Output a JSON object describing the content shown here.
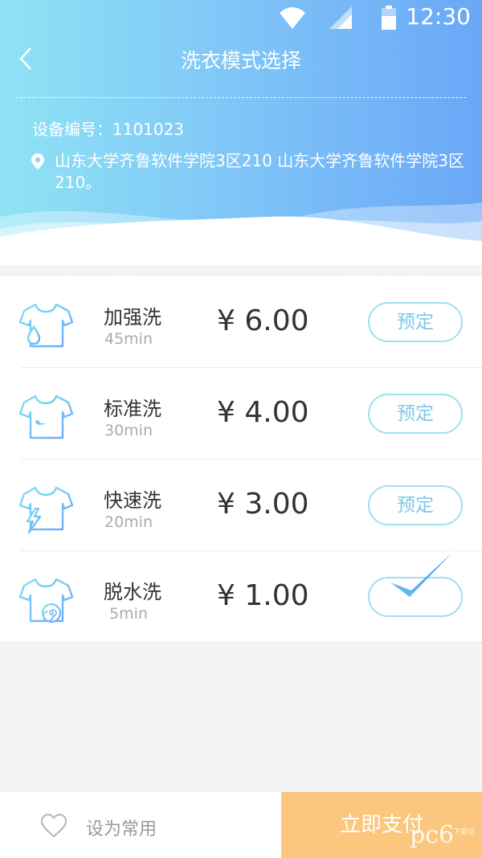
{
  "status_bar": {
    "time": "12:30"
  },
  "nav": {
    "title": "洗衣模式选择",
    "back_icon": "chevron-left-icon"
  },
  "device": {
    "id_text": "设备编号：1101023",
    "address": "山东大学齐鲁软件学院3区210 山东大学齐鲁软件学院3区210。"
  },
  "modes": [
    {
      "name": "加强洗",
      "duration": "45min",
      "price": "¥ 6.00",
      "action": "预定",
      "icon": "shirt-droplet-icon",
      "selected": false
    },
    {
      "name": "标准洗",
      "duration": "30min",
      "price": "¥ 4.00",
      "action": "预定",
      "icon": "shirt-swoosh-icon",
      "selected": false
    },
    {
      "name": "快速洗",
      "duration": "20min",
      "price": "¥ 3.00",
      "action": "预定",
      "icon": "shirt-lightning-icon",
      "selected": false
    },
    {
      "name": "脱水洗",
      "duration": "5min",
      "price": "¥ 1.00",
      "action": "",
      "icon": "shirt-spin-icon",
      "selected": true
    }
  ],
  "bottom": {
    "favorite_label": "设为常用",
    "pay_label": "立即支付"
  },
  "watermark": {
    "logo": "pc6",
    "sub": "下载站"
  },
  "colors": {
    "header_start": "#8fe3f4",
    "header_end": "#6aa7f7",
    "accent": "#7cc8e8",
    "pay": "#fbc77e"
  }
}
